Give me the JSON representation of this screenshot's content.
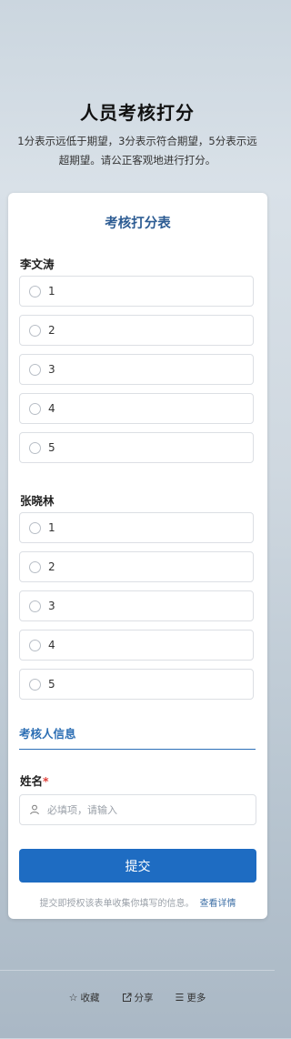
{
  "header": {
    "title": "人员考核打分",
    "description": "1分表示远低于期望，3分表示符合期望，5分表示远超期望。请公正客观地进行打分。"
  },
  "form": {
    "title": "考核打分表",
    "questions": [
      {
        "name": "李文涛",
        "options": [
          "1",
          "2",
          "3",
          "4",
          "5"
        ]
      },
      {
        "name": "张晓林",
        "options": [
          "1",
          "2",
          "3",
          "4",
          "5"
        ]
      }
    ],
    "section_title": "考核人信息",
    "name_field": {
      "label": "姓名",
      "required_mark": "*",
      "placeholder": "必填项，请输入",
      "value": ""
    },
    "submit_label": "提交",
    "notice_text": "提交即授权该表单收集你填写的信息。",
    "notice_link": "查看详情"
  },
  "footer": {
    "items": [
      {
        "label": "收藏",
        "icon": "star-icon"
      },
      {
        "label": "分享",
        "icon": "share-icon"
      },
      {
        "label": "更多",
        "icon": "menu-icon"
      }
    ]
  },
  "colors": {
    "accent": "#1e6cc2",
    "title_blue": "#2d5c93",
    "required": "#e0403a"
  }
}
